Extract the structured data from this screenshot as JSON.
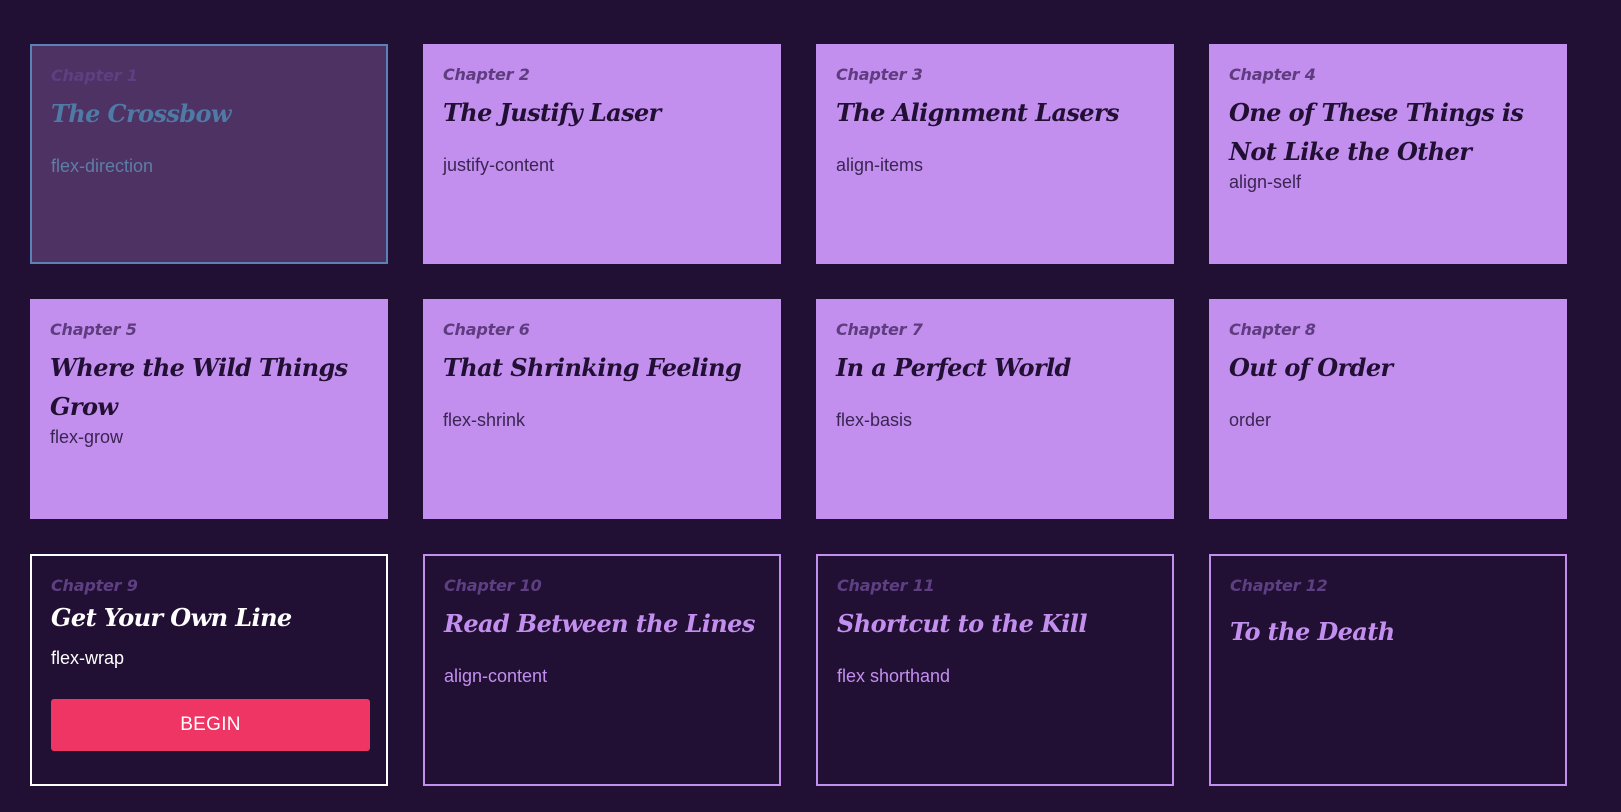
{
  "chapters": [
    {
      "chapter": "Chapter 1",
      "title": "The Crossbow",
      "property": "flex-direction",
      "state": "solved"
    },
    {
      "chapter": "Chapter 2",
      "title": "The Justify Laser",
      "property": "justify-content",
      "state": "done"
    },
    {
      "chapter": "Chapter 3",
      "title": "The Alignment Lasers",
      "property": "align-items",
      "state": "done"
    },
    {
      "chapter": "Chapter 4",
      "title": "One of These Things is Not Like the Other",
      "property": "align-self",
      "state": "done"
    },
    {
      "chapter": "Chapter 5",
      "title": "Where the Wild Things Grow",
      "property": "flex-grow",
      "state": "done"
    },
    {
      "chapter": "Chapter 6",
      "title": "That Shrinking Feeling",
      "property": "flex-shrink",
      "state": "done"
    },
    {
      "chapter": "Chapter 7",
      "title": "In a Perfect World",
      "property": "flex-basis",
      "state": "done"
    },
    {
      "chapter": "Chapter 8",
      "title": "Out of Order",
      "property": "order",
      "state": "done"
    },
    {
      "chapter": "Chapter 9",
      "title": "Get Your Own Line",
      "property": "flex-wrap",
      "state": "current"
    },
    {
      "chapter": "Chapter 10",
      "title": "Read Between the Lines",
      "property": "align-content",
      "state": "locked"
    },
    {
      "chapter": "Chapter 11",
      "title": "Shortcut to the Kill",
      "property": "flex shorthand",
      "state": "locked"
    },
    {
      "chapter": "Chapter 12",
      "title": "To the Death",
      "property": "",
      "state": "locked"
    }
  ],
  "begin_button": {
    "label": "BEGIN"
  },
  "colors": {
    "background": "#211033",
    "card_done": "#c38fef",
    "card_solved": "#4d3263",
    "solved_accent": "#5b82b7",
    "begin_button": "#ee3563"
  }
}
